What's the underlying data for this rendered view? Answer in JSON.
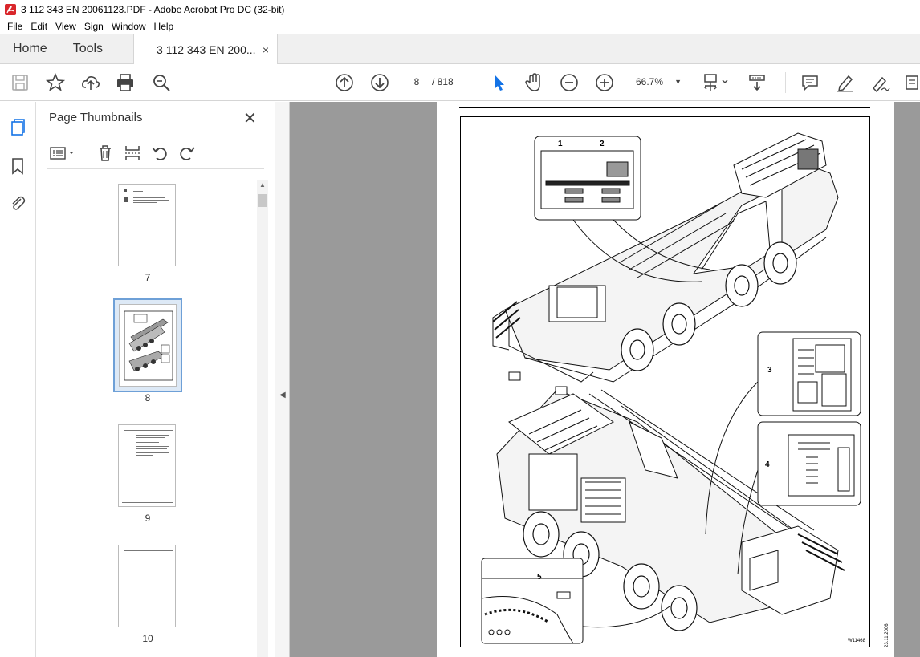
{
  "window": {
    "title": "3 112 343 EN 20061123.PDF - Adobe Acrobat Pro DC (32-bit)"
  },
  "menu": [
    "File",
    "Edit",
    "View",
    "Sign",
    "Window",
    "Help"
  ],
  "tabs": {
    "home": "Home",
    "tools": "Tools",
    "document": "3 112 343 EN 200...",
    "close": "×"
  },
  "toolbar": {
    "page_current": "8",
    "page_total": "/  818",
    "zoom": "66.7%"
  },
  "thumbnails_panel": {
    "title": "Page Thumbnails",
    "close": "✕",
    "pages": [
      {
        "label": "7"
      },
      {
        "label": "8",
        "selected": true
      },
      {
        "label": "9"
      },
      {
        "label": "10"
      }
    ]
  },
  "document": {
    "callouts": [
      "1",
      "2",
      "3",
      "4",
      "5"
    ],
    "figure_code": "W11468",
    "side_date": "23.11.2006"
  },
  "colors": {
    "selection_border": "#6ea0d7",
    "viewer_background": "#9a9a9a",
    "acrobat_red": "#d9262b"
  }
}
